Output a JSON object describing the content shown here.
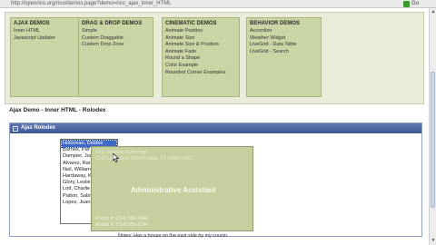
{
  "browser": {
    "url": "http://openrico.org/rico/demos.page?demo=rico_ajax_inner_HTML",
    "go_label": "Go"
  },
  "nav": [
    {
      "heading": "AJAX DEMOS",
      "items": [
        "Inner HTML",
        "Javascript Updater"
      ]
    },
    {
      "heading": "DRAG & DROP DEMOS",
      "items": [
        "Simple",
        "Custom Draggable",
        "Custom Drop Zone"
      ]
    },
    {
      "heading": "CINEMATIC DEMOS",
      "items": [
        "Animate Position",
        "Animate Size",
        "Animate Size & Position",
        "Animate Fade",
        "Round a Shape",
        "Color Example",
        "Rounded Corner Examples"
      ]
    },
    {
      "heading": "BEHAVIOR DEMOS",
      "items": [
        "Accordion",
        "Weather Widget",
        "LiveGrid - Data Table",
        "LiveGrid - Search"
      ]
    }
  ],
  "demo_title": "Ajax Demo - Inner HTML - Rolodex",
  "panel": {
    "title": "Ajax Rolodex",
    "toggle": "-"
  },
  "contacts": {
    "selected_index": 0,
    "names": [
      "Holtzman, Debbie",
      "Barnes, Pat",
      "Dampier, Joan",
      "Alvarez, Randy",
      "Neil, William",
      "Hardaway, Kimber",
      "Glory, Leslie",
      "Lott, Charlie",
      "Patton, Sabrina",
      "Lopez, Juan"
    ]
  },
  "card": {
    "name": "Mrs. Debbie Holtzman",
    "address": "2340 Lakeshore Street Dallas, TX 75080-3422",
    "title": "Administrative Assistant",
    "phone": "Phone #: (214) 555-2343",
    "mobile": "Mobile #: (214) 555-2144",
    "notes": "Notes: Has a house on the east side by my cousin."
  },
  "colors": {
    "nav_band": "#e9ecd9",
    "nav_box": "#c9d5a4",
    "panel_bar": "#4a64a2",
    "card": "#c5d09e",
    "selected": "#3f69c7"
  }
}
